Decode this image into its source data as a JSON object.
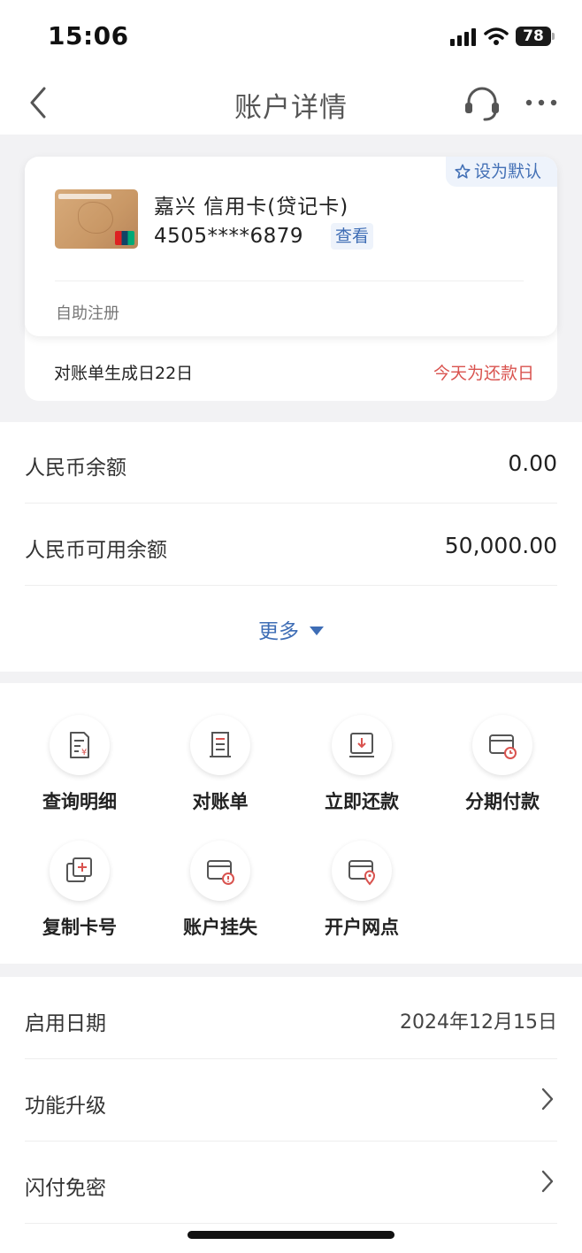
{
  "status_bar": {
    "time": "15:06",
    "battery": "78"
  },
  "nav": {
    "title": "账户详情"
  },
  "card": {
    "set_default": "设为默认",
    "name": "嘉兴 信用卡(贷记卡)",
    "number": "4505****6879",
    "view": "查看",
    "registration": "自助注册",
    "statement_day": "对账单生成日22日",
    "due_notice": "今天为还款日",
    "due_color": "#d9534f"
  },
  "balances": {
    "rows": [
      {
        "label": "人民币余额",
        "value": "0.00"
      },
      {
        "label": "人民币可用余额",
        "value": "50,000.00"
      }
    ],
    "more": "更多"
  },
  "functions": [
    {
      "label": "查询明细",
      "icon": "detail-query-icon"
    },
    {
      "label": "对账单",
      "icon": "statement-icon"
    },
    {
      "label": "立即还款",
      "icon": "repay-icon"
    },
    {
      "label": "分期付款",
      "icon": "installment-icon"
    },
    {
      "label": "复制卡号",
      "icon": "copy-card-icon"
    },
    {
      "label": "账户挂失",
      "icon": "report-loss-icon"
    },
    {
      "label": "开户网点",
      "icon": "branch-location-icon"
    }
  ],
  "info": [
    {
      "label": "启用日期",
      "value": "2024年12月15日"
    },
    {
      "label": "功能升级"
    },
    {
      "label": "闪付免密"
    }
  ],
  "colors": {
    "accent_blue": "#3e6db5",
    "icon_red": "#d9534f"
  }
}
